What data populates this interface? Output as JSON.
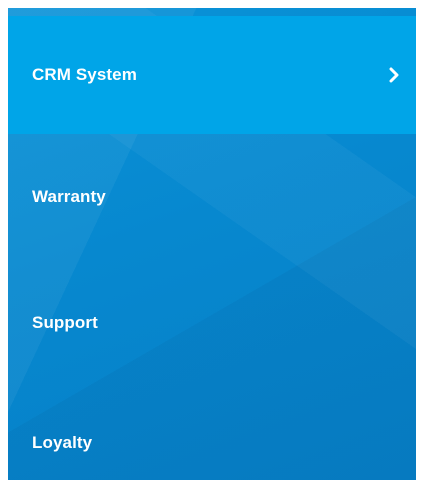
{
  "menu": {
    "items": [
      {
        "label": "CRM System",
        "active": true,
        "icon": "chevron-right-icon"
      },
      {
        "label": "Warranty",
        "active": false
      },
      {
        "label": "Support",
        "active": false
      },
      {
        "label": "Loyalty",
        "active": false
      }
    ]
  },
  "colors": {
    "active_background": "#00a5e8",
    "menu_background": "#0788cf",
    "text": "#ffffff"
  }
}
